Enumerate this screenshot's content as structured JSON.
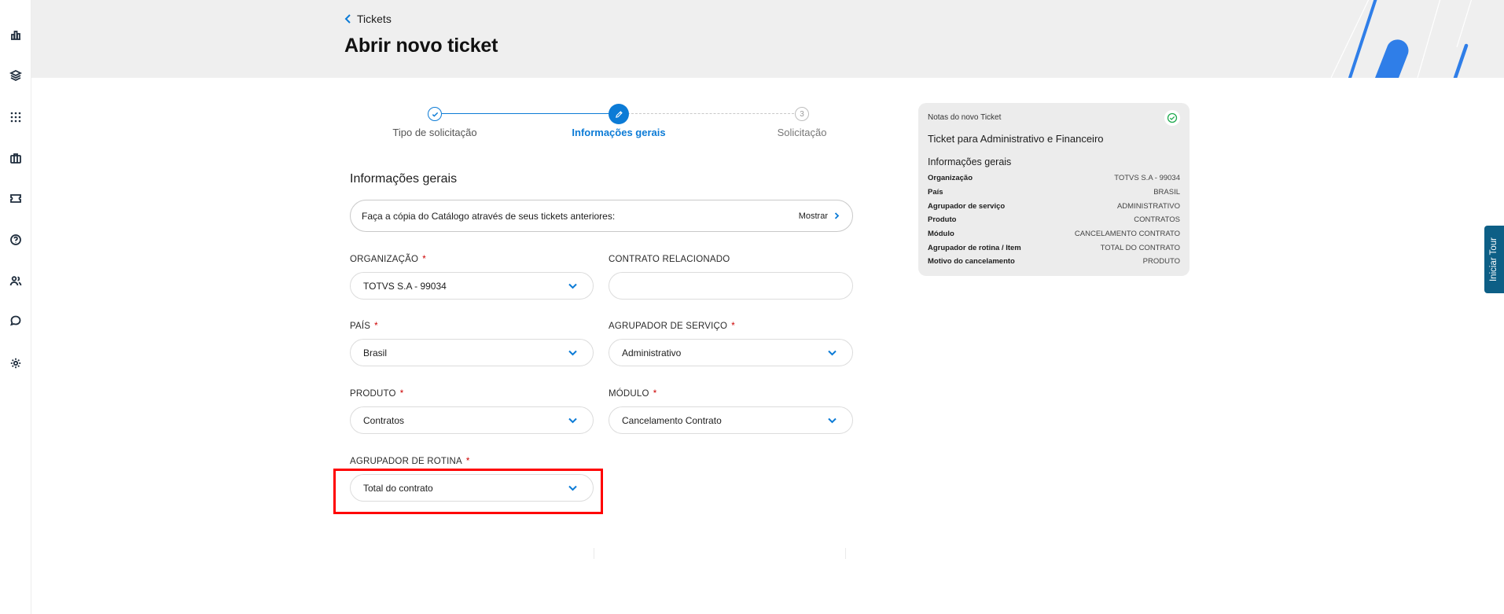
{
  "header": {
    "back_label": "Tickets",
    "title": "Abrir novo ticket"
  },
  "sidebar": {
    "items": [
      "chart-icon",
      "layers-icon",
      "apps-icon",
      "briefcase-icon",
      "ticket-icon",
      "help-icon",
      "users-icon",
      "chat-icon",
      "gear-icon"
    ]
  },
  "stepper": {
    "steps": [
      {
        "label": "Tipo de solicitação",
        "state": "done"
      },
      {
        "label": "Informações gerais",
        "state": "active"
      },
      {
        "label": "Solicitação",
        "state": "pending",
        "number": "3"
      }
    ]
  },
  "form": {
    "section_title": "Informações gerais",
    "copy_text": "Faça a cópia do Catálogo através de seus tickets anteriores:",
    "copy_action": "Mostrar",
    "required_mark": "*",
    "fields": {
      "organizacao": {
        "label": "ORGANIZAÇÃO",
        "value": "TOTVS S.A - 99034"
      },
      "contrato": {
        "label": "CONTRATO RELACIONADO",
        "value": ""
      },
      "pais": {
        "label": "PAÍS",
        "value": "Brasil"
      },
      "agrupador_servico": {
        "label": "AGRUPADOR DE SERVIÇO",
        "value": "Administrativo"
      },
      "produto": {
        "label": "PRODUTO",
        "value": "Contratos"
      },
      "modulo": {
        "label": "MÓDULO",
        "value": "Cancelamento Contrato"
      },
      "agrupador_rotina": {
        "label": "AGRUPADOR DE ROTINA",
        "value": "Total do contrato"
      }
    }
  },
  "notes": {
    "header": "Notas do novo Ticket",
    "ticket_title": "Ticket para Administrativo e Financeiro",
    "section": "Informações gerais",
    "rows": [
      {
        "key": "Organização",
        "value": "TOTVS S.A - 99034"
      },
      {
        "key": "País",
        "value": "BRASIL"
      },
      {
        "key": "Agrupador de serviço",
        "value": "ADMINISTRATIVO"
      },
      {
        "key": "Produto",
        "value": "CONTRATOS"
      },
      {
        "key": "Módulo",
        "value": "CANCELAMENTO CONTRATO"
      },
      {
        "key": "Agrupador de rotina / Item",
        "value": "TOTAL DO CONTRATO"
      },
      {
        "key": "Motivo do cancelamento",
        "value": "PRODUTO"
      }
    ]
  },
  "tour_button": "Iniciar Tour",
  "colors": {
    "accent": "#0c7bd6",
    "header_bg": "#efefef",
    "highlight": "#ff0000",
    "tour_bg": "#0d5f86"
  }
}
